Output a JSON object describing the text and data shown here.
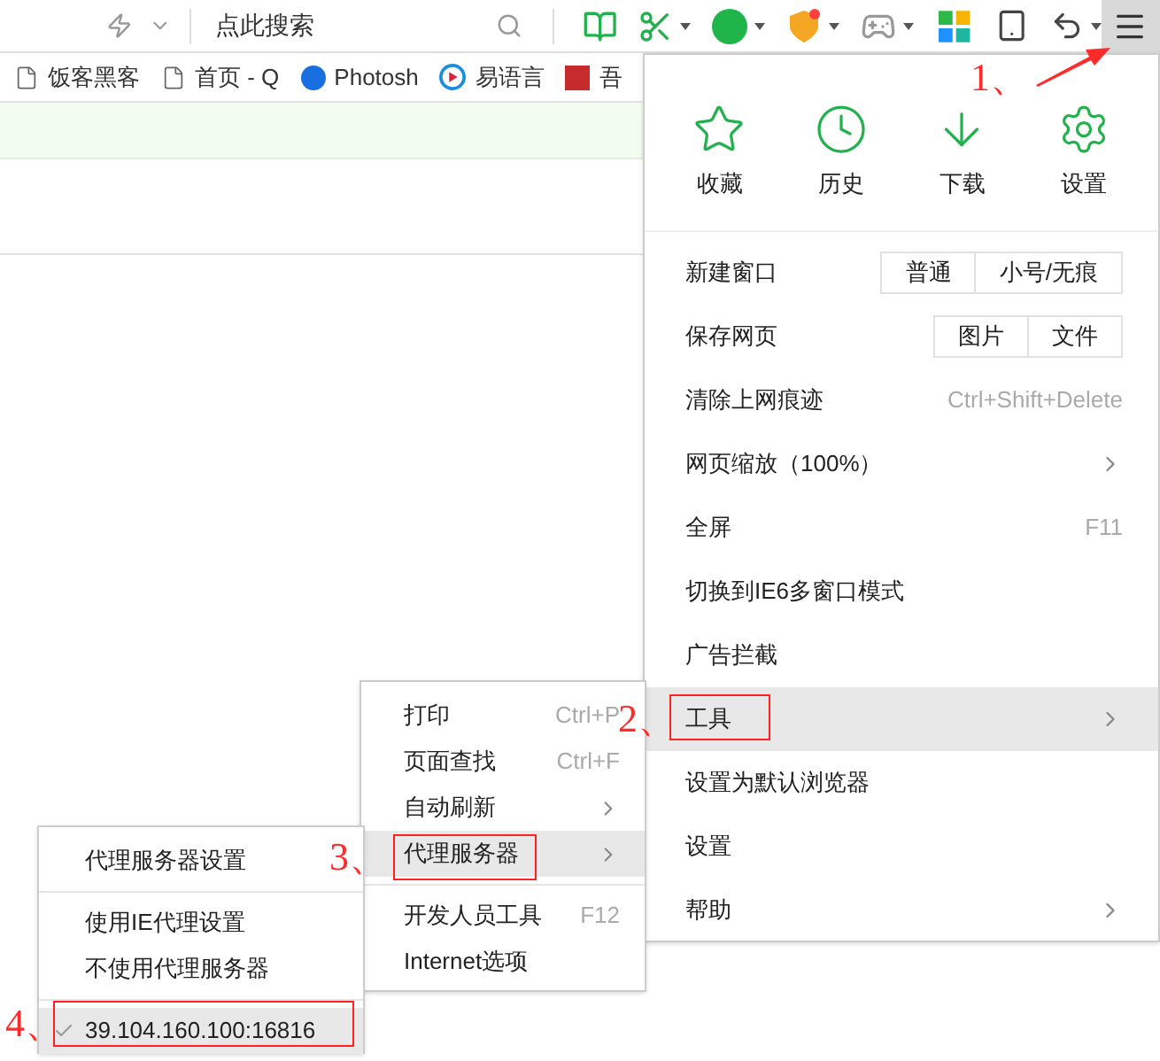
{
  "toolbar": {
    "search": {
      "placeholder": "点此搜索"
    },
    "menu_button": {
      "selected": true
    }
  },
  "bookmarks": [
    {
      "label": "饭客黑客",
      "kind": "page"
    },
    {
      "label": "首页 - Q",
      "kind": "page"
    },
    {
      "label": "Photosh",
      "kind": "photoshop"
    },
    {
      "label": "易语言",
      "kind": "video"
    },
    {
      "label": "吾",
      "kind": "seal"
    }
  ],
  "main_menu": {
    "top_items": [
      {
        "label": "收藏",
        "kind": "star"
      },
      {
        "label": "历史",
        "kind": "clock"
      },
      {
        "label": "下载",
        "kind": "download"
      },
      {
        "label": "设置",
        "kind": "gear"
      }
    ],
    "items": [
      {
        "label": "新建窗口",
        "buttons": [
          "普通",
          "小号/无痕"
        ],
        "submenu": false,
        "selected": false
      },
      {
        "label": "保存网页",
        "buttons": [
          "图片",
          "文件"
        ],
        "submenu": false,
        "selected": false
      },
      {
        "label": "清除上网痕迹",
        "shortcut": "Ctrl+Shift+Delete",
        "submenu": false,
        "selected": false
      },
      {
        "label": "网页缩放（100%）",
        "submenu": true,
        "selected": false
      },
      {
        "label": "全屏",
        "shortcut": "F11",
        "submenu": false,
        "selected": false
      },
      {
        "label": "切换到IE6多窗口模式",
        "submenu": false,
        "selected": false
      },
      {
        "label": "广告拦截",
        "submenu": false,
        "selected": false
      },
      {
        "label": "工具",
        "submenu": true,
        "selected": true
      },
      {
        "label": "设置为默认浏览器",
        "submenu": false,
        "selected": false
      },
      {
        "label": "设置",
        "submenu": false,
        "selected": false
      },
      {
        "label": "帮助",
        "submenu": true,
        "selected": false
      }
    ]
  },
  "tools_menu": {
    "items": [
      {
        "kind": "item",
        "label": "打印",
        "shortcut": "Ctrl+P",
        "submenu": false,
        "selected": false
      },
      {
        "kind": "item",
        "label": "页面查找",
        "shortcut": "Ctrl+F",
        "submenu": false,
        "selected": false
      },
      {
        "kind": "item",
        "label": "自动刷新",
        "submenu": true,
        "selected": false
      },
      {
        "kind": "item",
        "label": "代理服务器",
        "submenu": true,
        "selected": true
      },
      {
        "kind": "divider"
      },
      {
        "kind": "item",
        "label": "开发人员工具",
        "shortcut": "F12",
        "submenu": false,
        "selected": false
      },
      {
        "kind": "item",
        "label": "Internet选项",
        "submenu": false,
        "selected": false
      }
    ]
  },
  "proxy_menu": {
    "items": [
      {
        "kind": "item",
        "label": "代理服务器设置",
        "checked": false,
        "selected": false
      },
      {
        "kind": "divider"
      },
      {
        "kind": "item",
        "label": "使用IE代理设置",
        "checked": false,
        "selected": false
      },
      {
        "kind": "item",
        "label": "不使用代理服务器",
        "checked": false,
        "selected": false
      },
      {
        "kind": "divider"
      },
      {
        "kind": "item",
        "label": "39.104.160.100:16816",
        "checked": true,
        "selected": true
      }
    ]
  },
  "annotations": [
    "1、",
    "2、",
    "3、",
    "4、"
  ]
}
